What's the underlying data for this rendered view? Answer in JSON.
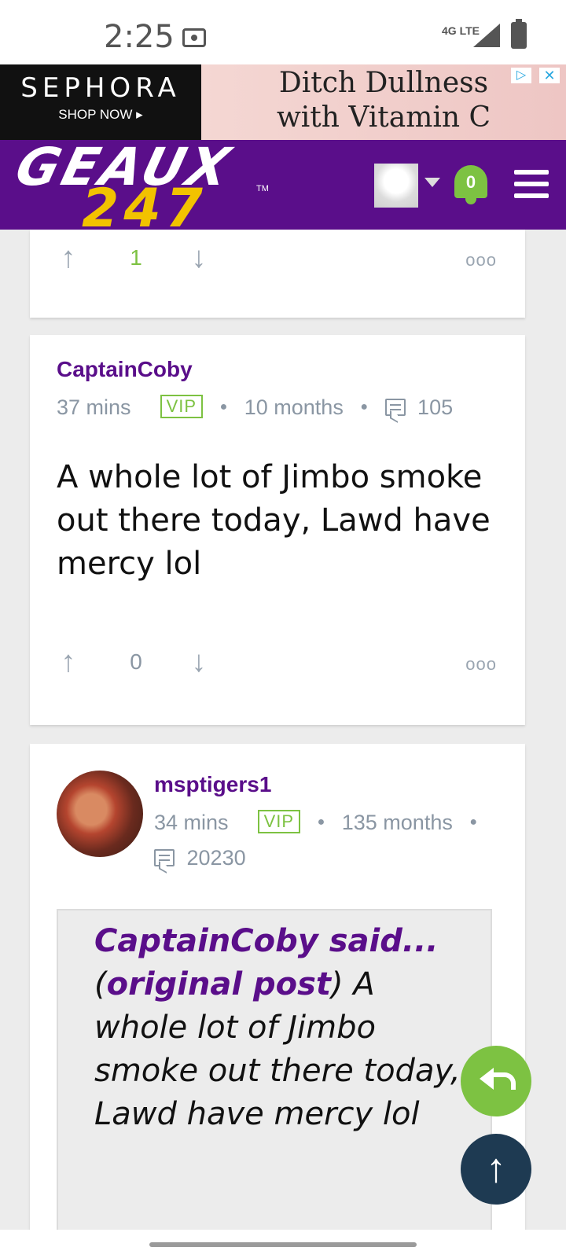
{
  "status_bar": {
    "time": "2:25",
    "network": "4G LTE"
  },
  "ad": {
    "brand": "SEPHORA",
    "cta": "SHOP NOW ▸",
    "headline_line1": "Ditch Dullness",
    "headline_line2": "with Vitamin C"
  },
  "header": {
    "logo_top": "GEAUX",
    "logo_bottom": "247",
    "logo_tm": "TM",
    "notification_count": "0"
  },
  "posts": [
    {
      "score": "1"
    },
    {
      "username": "CaptainCoby",
      "time": "37 mins",
      "badge": "VIP",
      "tenure": "10 months",
      "post_count": "105",
      "body": "A whole lot of Jimbo smoke out there today, Lawd have mercy lol",
      "score": "0"
    },
    {
      "username": "msptigers1",
      "time": "34 mins",
      "badge": "VIP",
      "tenure": "135 months",
      "post_count": "20230",
      "quote": {
        "author_said": "CaptainCoby said...",
        "link_text": "original post",
        "text": "A whole lot of Jimbo smoke out there today, Lawd have mercy lol"
      }
    }
  ],
  "colors": {
    "brand_purple": "#5a0e8a",
    "accent_green": "#7dc242",
    "navy": "#1e3a52"
  }
}
